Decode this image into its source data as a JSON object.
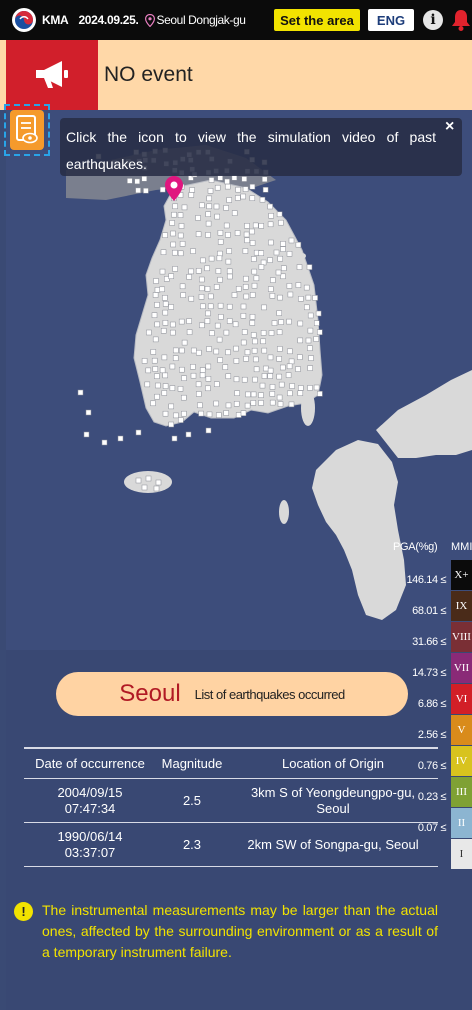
{
  "header": {
    "brand": "KMA",
    "date": "2024.09.25.",
    "location": "Seoul Dongjak-gu",
    "set_area_label": "Set the area",
    "lang_label": "ENG",
    "info_label": "i"
  },
  "banner": {
    "status": "NO event"
  },
  "tooltip": {
    "text": "Click the icon to view the simulation video of past earthquakes.",
    "close": "×"
  },
  "legend": {
    "pga_title": "PGA(%g)",
    "mmi_title": "MMI",
    "pga_values": [
      "146.14 ≤",
      "68.01 ≤",
      "31.66 ≤",
      "14.73 ≤",
      "6.86 ≤",
      "2.56 ≤",
      "0.76 ≤",
      "0.23 ≤",
      "0.07 ≤"
    ],
    "mmi_levels": [
      {
        "label": "X+",
        "color": "#0b0b0b",
        "text_color": "#ffffff"
      },
      {
        "label": "IX",
        "color": "#4a2b19",
        "text_color": "#ffffff"
      },
      {
        "label": "VIII",
        "color": "#7a2f35",
        "text_color": "#ffffff"
      },
      {
        "label": "VII",
        "color": "#8a2a77",
        "text_color": "#ffffff"
      },
      {
        "label": "VI",
        "color": "#d21f27",
        "text_color": "#ffffff"
      },
      {
        "label": "V",
        "color": "#d98b1b",
        "text_color": "#ffffff"
      },
      {
        "label": "IV",
        "color": "#d8c31e",
        "text_color": "#ffffff"
      },
      {
        "label": "III",
        "color": "#7fa134",
        "text_color": "#ffffff"
      },
      {
        "label": "II",
        "color": "#8cb5d1",
        "text_color": "#ffffff"
      },
      {
        "label": "I",
        "color": "#e8e8e8",
        "text_color": "#333333"
      }
    ]
  },
  "list": {
    "region": "Seoul",
    "subtitle": "List of earthquakes occurred",
    "headers": {
      "date": "Date of occurrence",
      "magnitude": "Magnitude",
      "origin": "Location of Origin"
    },
    "rows": [
      {
        "date": "2004/09/15",
        "time": "07:47:34",
        "magnitude": "2.5",
        "origin1": "3km S of Yeongdeungpo-gu,",
        "origin2": "Seoul"
      },
      {
        "date": "1990/06/14",
        "time": "03:37:07",
        "magnitude": "2.3",
        "origin1": "2km SW of Songpa-gu, Seoul",
        "origin2": ""
      }
    ]
  },
  "warning": {
    "icon": "!",
    "text": "The instrumental measurements may be larger than the actual ones, affected by the surrounding environment or as a result of a temporary instrument failure."
  },
  "colors": {
    "accent_red": "#d11f2b",
    "banner_bg": "#ffd8a8",
    "map_sea": "#3d4d7b",
    "land": "#d9d9d9",
    "pin": "#e0167f",
    "highlight_yellow": "#f2e300"
  },
  "icons": {
    "logo": "kma-taeguk-icon",
    "pin": "location-pin-icon",
    "info": "info-icon",
    "bell": "bell-icon",
    "megaphone": "megaphone-icon",
    "simulation": "simulation-document-icon"
  }
}
